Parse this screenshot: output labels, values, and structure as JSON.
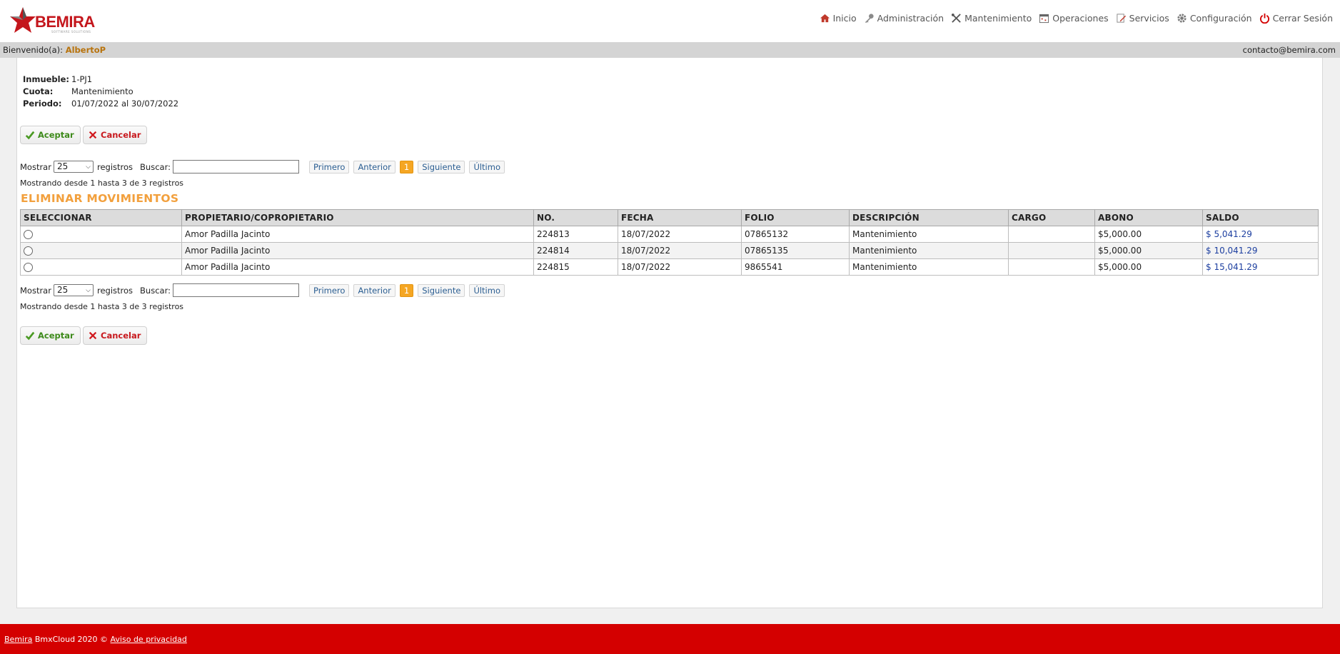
{
  "brand": {
    "logo_text": "BEMIRA",
    "logo_subtitle": "SOFTWARE SOLUTIONS",
    "color": "#c4161c"
  },
  "nav": [
    {
      "label": "Inicio",
      "icon": "home-icon"
    },
    {
      "label": "Administración",
      "icon": "key-icon"
    },
    {
      "label": "Mantenimiento",
      "icon": "tools-icon"
    },
    {
      "label": "Operaciones",
      "icon": "calendar-icon"
    },
    {
      "label": "Servicios",
      "icon": "edit-icon"
    },
    {
      "label": "Configuración",
      "icon": "gear-icon"
    },
    {
      "label": "Cerrar Sesión",
      "icon": "power-icon"
    }
  ],
  "welcome": {
    "prefix": "Bienvenido(a):",
    "user": "AlbertoP",
    "contact": "contacto@bemira.com"
  },
  "info": {
    "inmueble_label": "Inmueble:",
    "inmueble_value": "1-PJ1",
    "cuota_label": "Cuota:",
    "cuota_value": "Mantenimiento",
    "periodo_label": "Periodo:",
    "periodo_value": "01/07/2022 al 30/07/2022"
  },
  "actions": {
    "accept": "Aceptar",
    "cancel": "Cancelar"
  },
  "controls": {
    "show_label": "Mostrar",
    "page_size": "25",
    "records_label": "registros",
    "search_label": "Buscar:",
    "search_value": "",
    "pager": {
      "first": "Primero",
      "prev": "Anterior",
      "current": "1",
      "next": "Siguiente",
      "last": "Último"
    },
    "showing_text": "Mostrando desde 1 hasta 3 de 3 registros"
  },
  "section_title": "ELIMINAR MOVIMIENTOS",
  "table": {
    "headers": [
      "SELECCIONAR",
      "PROPIETARIO/COPROPIETARIO",
      "NO.",
      "FECHA",
      "FOLIO",
      "DESCRIPCIÓN",
      "CARGO",
      "ABONO",
      "SALDO"
    ],
    "rows": [
      {
        "owner": "Amor Padilla Jacinto",
        "no": "224813",
        "fecha": "18/07/2022",
        "folio": "07865132",
        "descripcion": "Mantenimiento",
        "cargo": "",
        "abono": "$5,000.00",
        "saldo": "$ 5,041.29"
      },
      {
        "owner": "Amor Padilla Jacinto",
        "no": "224814",
        "fecha": "18/07/2022",
        "folio": "07865135",
        "descripcion": "Mantenimiento",
        "cargo": "",
        "abono": "$5,000.00",
        "saldo": "$ 10,041.29"
      },
      {
        "owner": "Amor Padilla Jacinto",
        "no": "224815",
        "fecha": "18/07/2022",
        "folio": "9865541",
        "descripcion": "Mantenimiento",
        "cargo": "",
        "abono": "$5,000.00",
        "saldo": "$ 15,041.29"
      }
    ]
  },
  "footer": {
    "brand_link": "Bemira",
    "text": " BmxCloud 2020 © ",
    "privacy_link": "Aviso de privacidad"
  },
  "colors": {
    "accent_orange": "#f2a03d",
    "footer_red": "#d40000",
    "saldo_blue": "#1d3fa0"
  }
}
